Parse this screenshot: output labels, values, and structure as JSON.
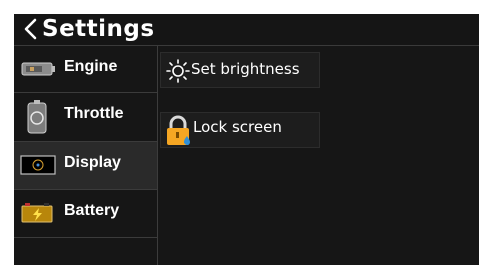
{
  "header": {
    "title": "Settings"
  },
  "sidebar": {
    "items": [
      {
        "label": "Engine",
        "icon": "engine-icon",
        "selected": false
      },
      {
        "label": "Throttle",
        "icon": "throttle-icon",
        "selected": false
      },
      {
        "label": "Display",
        "icon": "display-icon",
        "selected": true
      },
      {
        "label": "Battery",
        "icon": "battery-icon",
        "selected": false
      }
    ]
  },
  "content": {
    "actions": [
      {
        "label": "Set brightness",
        "icon": "brightness-icon"
      },
      {
        "label": "Lock screen",
        "icon": "lock-icon"
      }
    ]
  },
  "colors": {
    "background": "#161616",
    "selected": "#2a2a2a",
    "text": "#ffffff",
    "lock": "#f5a623",
    "drop": "#2f8fd8"
  }
}
